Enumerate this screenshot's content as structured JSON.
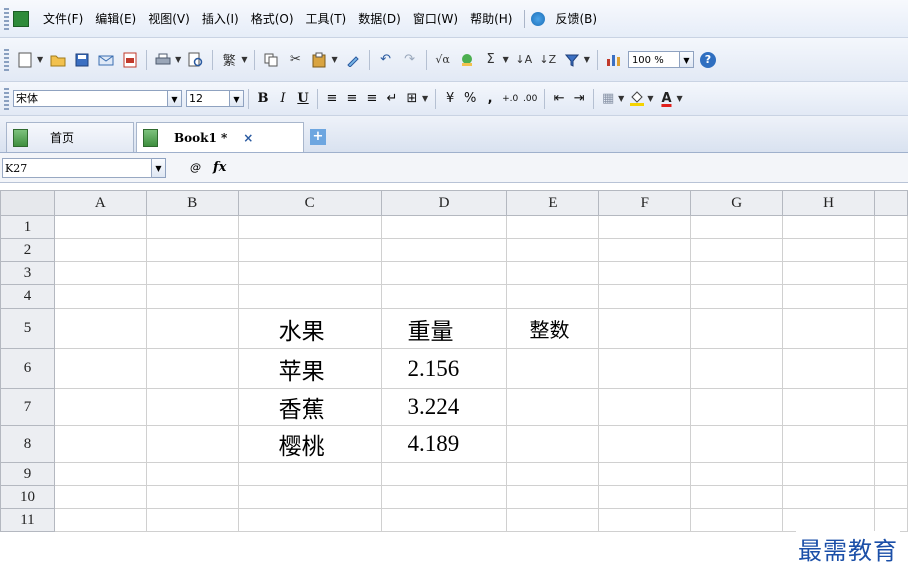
{
  "menu": {
    "items": [
      "文件(F)",
      "编辑(E)",
      "视图(V)",
      "插入(I)",
      "格式(O)",
      "工具(T)",
      "数据(D)",
      "窗口(W)",
      "帮助(H)"
    ],
    "feedback": "反馈(B)"
  },
  "toolbar": {
    "zoom": "100 %",
    "traditional": "繁",
    "icons": [
      "new-icon",
      "open-icon",
      "save-icon",
      "mail-icon",
      "pdf-icon",
      "print-icon",
      "print-preview-icon",
      "traditional-chinese-icon",
      "copy-icon",
      "cut-icon",
      "paste-icon",
      "format-painter-icon",
      "undo-icon",
      "redo-icon",
      "formula-icon",
      "spellcheck-icon",
      "sum-icon",
      "sort-asc-icon",
      "sort-desc-icon",
      "filter-icon",
      "chart-icon",
      "help-icon"
    ]
  },
  "format": {
    "font_name": "宋体",
    "font_size": "12",
    "bold": "B",
    "italic": "I",
    "underline": "U",
    "percent": "%",
    "comma": ",",
    "inc_decimal": "+.0",
    "dec_decimal": ".00",
    "font_color_label": "A"
  },
  "tabs": {
    "home": "首页",
    "book": "Book1 *",
    "close": "×",
    "add": "+"
  },
  "formula_bar": {
    "name_box": "K27",
    "fx": "fx",
    "zoom_symbol": "@",
    "content": ""
  },
  "grid": {
    "columns": [
      "A",
      "B",
      "C",
      "D",
      "E",
      "F",
      "G",
      "H"
    ],
    "rows": [
      {
        "n": "1",
        "c": "",
        "d": "",
        "e": ""
      },
      {
        "n": "2",
        "c": "",
        "d": "",
        "e": ""
      },
      {
        "n": "3",
        "c": "",
        "d": "",
        "e": ""
      },
      {
        "n": "4",
        "c": "",
        "d": "",
        "e": ""
      },
      {
        "n": "5",
        "c": "水果",
        "d": "重量",
        "e": "整数"
      },
      {
        "n": "6",
        "c": "苹果",
        "d": "2.156",
        "e": ""
      },
      {
        "n": "7",
        "c": "香蕉",
        "d": "3.224",
        "e": ""
      },
      {
        "n": "8",
        "c": "樱桃",
        "d": "4.189",
        "e": ""
      },
      {
        "n": "9",
        "c": "",
        "d": "",
        "e": ""
      },
      {
        "n": "10",
        "c": "",
        "d": "",
        "e": ""
      },
      {
        "n": "11",
        "c": "",
        "d": "",
        "e": ""
      }
    ]
  },
  "watermark": "最需教育",
  "colors": {
    "bar_blue": "#e2e9f5",
    "watermark": "#1b4fa8",
    "header_gray": "#eceef2"
  }
}
